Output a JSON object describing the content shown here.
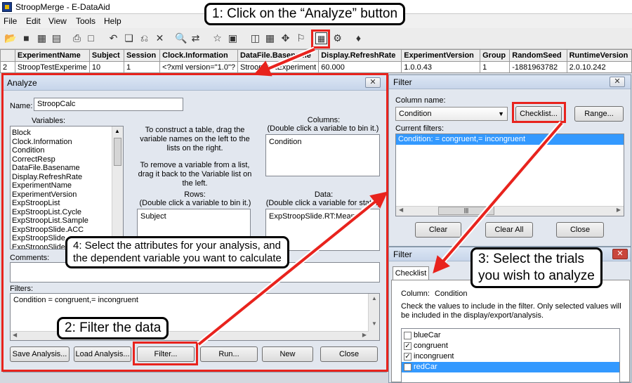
{
  "window": {
    "title": "StroopMerge - E-DataAid"
  },
  "menu": [
    "File",
    "Edit",
    "View",
    "Tools",
    "Help"
  ],
  "grid": {
    "columns": [
      "",
      "ExperimentName",
      "Subject",
      "Session",
      "Clock.Information",
      "DataFile.Basename",
      "Display.RefreshRate",
      "ExperimentVersion",
      "Group",
      "RandomSeed",
      "RuntimeVersion"
    ],
    "row": [
      "2",
      "StroopTestExperime",
      "10",
      "1",
      "<?xml version=\"1.0\"?",
      "StroopTestExperiment",
      "60.000",
      "1.0.0.43",
      "1",
      "-1881963782",
      "2.0.10.242"
    ]
  },
  "analyze": {
    "title": "Analyze",
    "name_label": "Name:",
    "name_value": "StroopCalc",
    "variables_label": "Variables:",
    "variables": [
      "Block",
      "Clock.Information",
      "Condition",
      "CorrectResp",
      "DataFile.Basename",
      "Display.RefreshRate",
      "ExperimentName",
      "ExperimentVersion",
      "ExpStroopList",
      "ExpStroopList.Cycle",
      "ExpStroopList.Sample",
      "ExpStroopSlide.ACC",
      "ExpStroopSlide...",
      "ExpStroopSlide..."
    ],
    "instructions1": "To construct a table, drag the variable names on the left to the lists on the right.",
    "instructions2": "To remove a variable from a list, drag it back to the Variable list on the left.",
    "columns_label": "Columns:",
    "columns_hint": "(Double click a variable to bin it.)",
    "columns_items": [
      "Condition"
    ],
    "rows_label": "Rows:",
    "rows_hint": "(Double click a variable to bin it.)",
    "rows_items": [
      "Subject"
    ],
    "data_label": "Data:",
    "data_hint": "(Double click a variable for stats.)",
    "data_items": [
      "ExpStroopSlide.RT:Mean"
    ],
    "comments_label": "Comments:",
    "filters_label": "Filters:",
    "filters_value": "Condition = congruent,= incongruent",
    "buttons": {
      "save": "Save Analysis...",
      "load": "Load Analysis...",
      "filter": "Filter...",
      "run": "Run...",
      "new": "New",
      "close": "Close"
    }
  },
  "filter": {
    "title": "Filter",
    "column_name_label": "Column name:",
    "column_value": "Condition",
    "checklist_button": "Checklist...",
    "range_button": "Range...",
    "current_filters_label": "Current filters:",
    "current_filters": [
      "Condition: = congruent,= incongruent"
    ],
    "clear_button": "Clear",
    "clear_all_button": "Clear All",
    "close_button": "Close"
  },
  "filter2": {
    "title": "Filter",
    "tab": "Checklist",
    "column_label": "Column:",
    "column_value": "Condition",
    "instructions": "Check the values to include in the filter.  Only selected values will be included in the display/export/analysis.",
    "values": [
      {
        "label": "blueCar",
        "checked": false
      },
      {
        "label": "congruent",
        "checked": true
      },
      {
        "label": "incongruent",
        "checked": true
      },
      {
        "label": "redCar",
        "checked": false
      }
    ]
  },
  "callouts": {
    "c1": "1: Click on the “Analyze” button",
    "c2": "2: Filter the data",
    "c3a": "3: Select the trials",
    "c3b": "you wish to analyze",
    "c4a": "4: Select the attributes for your analysis, and",
    "c4b": "the dependent variable you want to calculate"
  },
  "colors": {
    "annotation_red": "#e8231d",
    "selection_blue": "#3399ff"
  }
}
